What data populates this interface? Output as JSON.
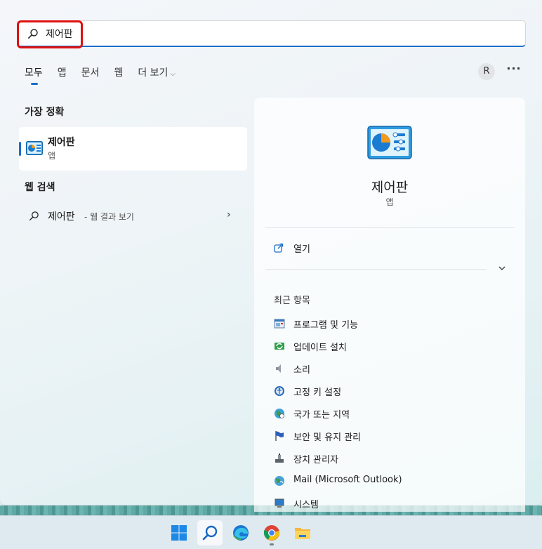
{
  "search": {
    "value": "제어판",
    "placeholder": ""
  },
  "tabs": [
    {
      "label": "모두"
    },
    {
      "label": "앱"
    },
    {
      "label": "문서"
    },
    {
      "label": "웹"
    },
    {
      "label": "더 보기"
    }
  ],
  "account": {
    "initial": "R"
  },
  "more_label": "···",
  "best_match": {
    "section_title": "가장 정확",
    "name": "제어판",
    "type": "앱"
  },
  "web_search": {
    "section_title": "웹 검색",
    "query": "제어판",
    "hint": "- 웹 결과 보기"
  },
  "detail": {
    "title": "제어판",
    "type": "앱",
    "open_label": "열기",
    "recent_title": "최근 항목",
    "recent_items": [
      {
        "label": "프로그램 및 기능",
        "icon": "programs-icon"
      },
      {
        "label": "업데이트 설치",
        "icon": "update-icon"
      },
      {
        "label": "소리",
        "icon": "speaker-icon"
      },
      {
        "label": "고정 키 설정",
        "icon": "ease-of-access-icon"
      },
      {
        "label": "국가 또는 지역",
        "icon": "globe-clock-icon"
      },
      {
        "label": "보안 및 유지 관리",
        "icon": "flag-icon"
      },
      {
        "label": "장치 관리자",
        "icon": "device-manager-icon"
      },
      {
        "label": "Mail (Microsoft Outlook)",
        "icon": "mail-globe-icon"
      },
      {
        "label": "시스템",
        "icon": "system-icon"
      }
    ]
  },
  "taskbar": {
    "items": [
      "start-icon",
      "search-icon",
      "edge-icon",
      "chrome-icon",
      "file-explorer-icon"
    ]
  },
  "colors": {
    "accent": "#1a6ec9",
    "highlight_box": "#e01010"
  }
}
